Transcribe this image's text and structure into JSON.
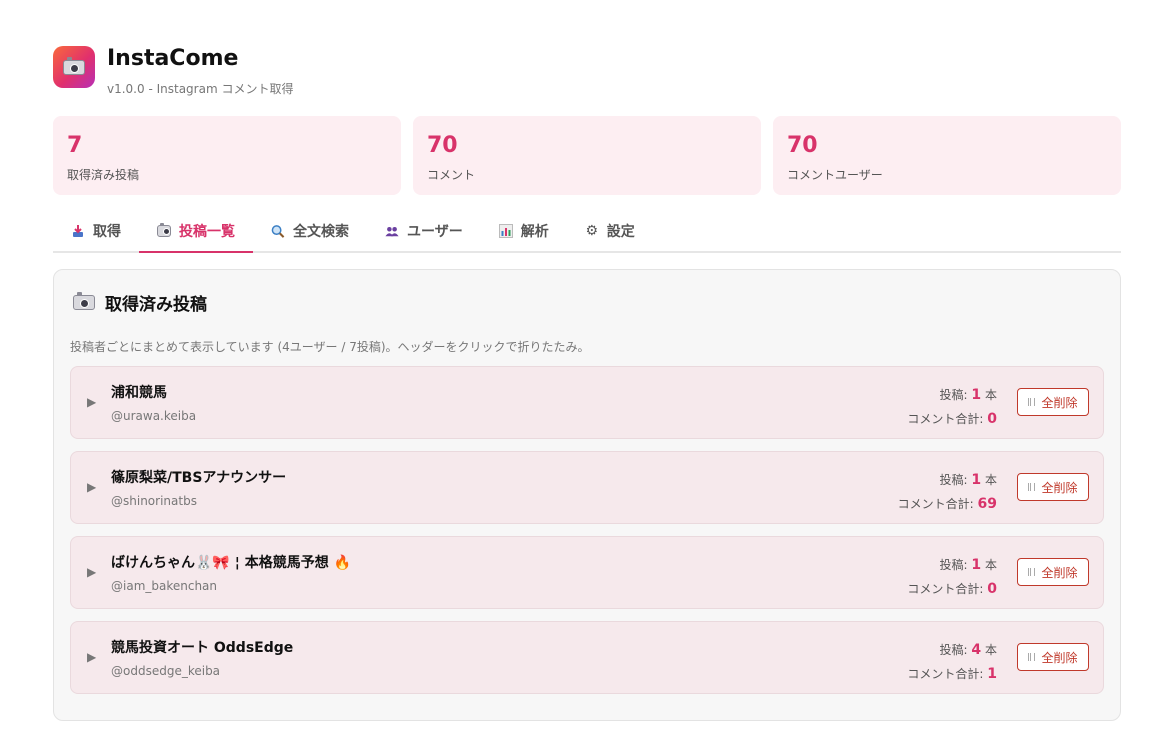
{
  "app": {
    "icon": "camera-icon",
    "title": "InstaCome",
    "subtitle": "v1.0.0 - Instagram コメント取得",
    "accent": "#d8336a"
  },
  "stats": [
    {
      "value": "7",
      "label": "取得済み投稿"
    },
    {
      "value": "70",
      "label": "コメント"
    },
    {
      "value": "70",
      "label": "コメントユーザー"
    }
  ],
  "tabs": [
    {
      "icon": "download-icon",
      "label": "取得",
      "active": false
    },
    {
      "icon": "camera-icon",
      "label": "投稿一覧",
      "active": true
    },
    {
      "icon": "search-icon",
      "label": "全文検索",
      "active": false
    },
    {
      "icon": "users-icon",
      "label": "ユーザー",
      "active": false
    },
    {
      "icon": "chart-icon",
      "label": "解析",
      "active": false
    },
    {
      "icon": "gear-icon",
      "label": "設定",
      "active": false
    }
  ],
  "panel": {
    "title": "取得済み投稿",
    "description": "投稿者ごとにまとめて表示しています (4ユーザー / 7投稿)。ヘッダーをクリックで折りたたみ。",
    "posts_label": "投稿:",
    "posts_unit": "本",
    "comments_label": "コメント合計:",
    "delete_label": "全削除",
    "groups": [
      {
        "name": "浦和競馬",
        "handle": "@urawa.keiba",
        "posts": "1",
        "comments": "0"
      },
      {
        "name": "篠原梨菜/TBSアナウンサー",
        "handle": "@shinorinatbs",
        "posts": "1",
        "comments": "69"
      },
      {
        "name": "ばけんちゃん🐰🎀 ¦ 本格競馬予想 🔥",
        "handle": "@iam_bakenchan",
        "posts": "1",
        "comments": "0"
      },
      {
        "name": "競馬投資オート OddsEdge",
        "handle": "@oddsedge_keiba",
        "posts": "4",
        "comments": "1"
      }
    ]
  }
}
